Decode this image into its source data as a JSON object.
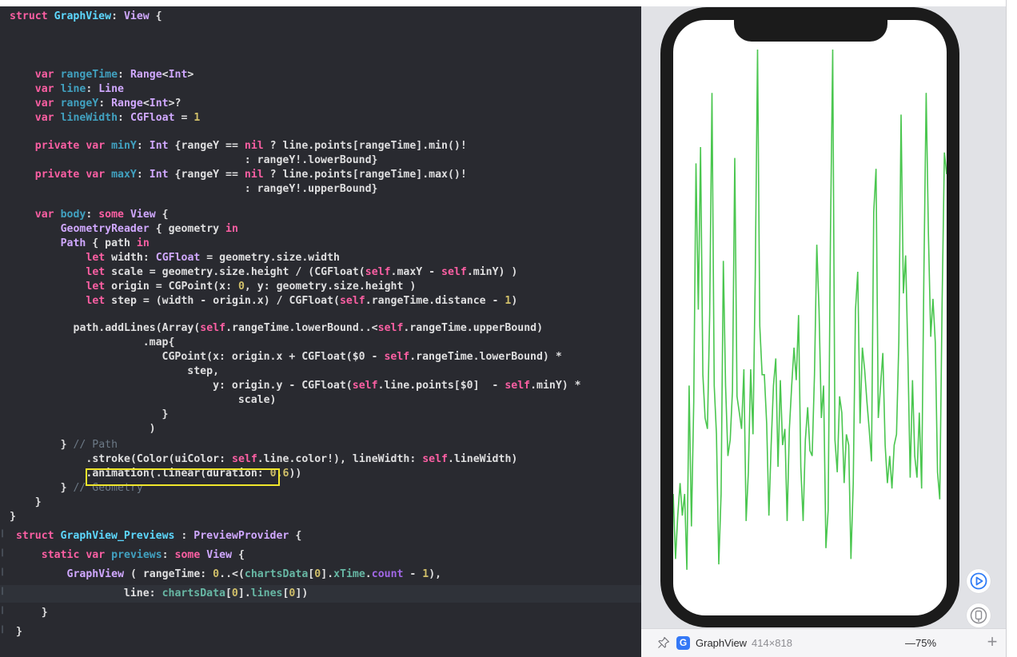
{
  "editor": {
    "lines": [
      {
        "top": 14,
        "indent": 0,
        "tokens": [
          [
            "kw",
            "struct"
          ],
          [
            "plain",
            " "
          ],
          [
            "typeD",
            "GraphView"
          ],
          [
            "plain",
            ": "
          ],
          [
            "type",
            "View"
          ],
          [
            "plain",
            " {"
          ]
        ]
      },
      {
        "top": 58,
        "indent": 4,
        "tokens": [
          [
            "kw",
            "var"
          ],
          [
            "plain",
            " "
          ],
          [
            "prop",
            "rangeTime"
          ],
          [
            "plain",
            ": "
          ],
          [
            "type",
            "Range"
          ],
          [
            "plain",
            "<"
          ],
          [
            "type",
            "Int"
          ],
          [
            "plain",
            ">"
          ]
        ]
      },
      {
        "top": 80,
        "indent": 4,
        "tokens": [
          [
            "kw",
            "var"
          ],
          [
            "plain",
            " "
          ],
          [
            "prop",
            "line"
          ],
          [
            "plain",
            ": "
          ],
          [
            "type",
            "Line"
          ]
        ]
      },
      {
        "top": 102,
        "indent": 4,
        "tokens": [
          [
            "kw",
            "var"
          ],
          [
            "plain",
            " "
          ],
          [
            "prop",
            "rangeY"
          ],
          [
            "plain",
            ": "
          ],
          [
            "type",
            "Range"
          ],
          [
            "plain",
            "<"
          ],
          [
            "type",
            "Int"
          ],
          [
            "plain",
            ">?"
          ]
        ]
      },
      {
        "top": 124,
        "indent": 4,
        "tokens": [
          [
            "kw",
            "var"
          ],
          [
            "plain",
            " "
          ],
          [
            "prop",
            "lineWidth"
          ],
          [
            "plain",
            ": "
          ],
          [
            "type",
            "CGFloat"
          ],
          [
            "plain",
            " = "
          ],
          [
            "num",
            "1"
          ]
        ]
      },
      {
        "top": 168,
        "indent": 4,
        "tokens": [
          [
            "kw",
            "private"
          ],
          [
            "plain",
            " "
          ],
          [
            "kw",
            "var"
          ],
          [
            "plain",
            " "
          ],
          [
            "prop",
            "minY"
          ],
          [
            "plain",
            ": "
          ],
          [
            "type",
            "Int"
          ],
          [
            "plain",
            " {rangeY == "
          ],
          [
            "kw",
            "nil"
          ],
          [
            "plain",
            " ? line.points[rangeTime].min()!"
          ]
        ]
      },
      {
        "top": 190,
        "indent": 0,
        "tokens": [
          [
            "plain",
            "                                     : rangeY!.lowerBound}"
          ]
        ]
      },
      {
        "top": 212,
        "indent": 4,
        "tokens": [
          [
            "kw",
            "private"
          ],
          [
            "plain",
            " "
          ],
          [
            "kw",
            "var"
          ],
          [
            "plain",
            " "
          ],
          [
            "prop",
            "maxY"
          ],
          [
            "plain",
            ": "
          ],
          [
            "type",
            "Int"
          ],
          [
            "plain",
            " {rangeY == "
          ],
          [
            "kw",
            "nil"
          ],
          [
            "plain",
            " ? line.points[rangeTime].max()!"
          ]
        ]
      },
      {
        "top": 234,
        "indent": 0,
        "tokens": [
          [
            "plain",
            "                                     : rangeY!.upperBound}"
          ]
        ]
      },
      {
        "top": 278,
        "indent": 4,
        "tokens": [
          [
            "kw",
            "var"
          ],
          [
            "plain",
            " "
          ],
          [
            "prop",
            "body"
          ],
          [
            "plain",
            ": "
          ],
          [
            "kw",
            "some"
          ],
          [
            "plain",
            " "
          ],
          [
            "type",
            "View"
          ],
          [
            "plain",
            " {"
          ]
        ]
      },
      {
        "top": 300,
        "indent": 8,
        "tokens": [
          [
            "type",
            "GeometryReader"
          ],
          [
            "plain",
            " { geometry "
          ],
          [
            "kw",
            "in"
          ]
        ]
      },
      {
        "top": 322,
        "indent": 8,
        "tokens": [
          [
            "type",
            "Path"
          ],
          [
            "plain",
            " { path "
          ],
          [
            "kw",
            "in"
          ]
        ]
      },
      {
        "top": 344,
        "indent": 12,
        "tokens": [
          [
            "kw",
            "let"
          ],
          [
            "plain",
            " width: "
          ],
          [
            "type",
            "CGFloat"
          ],
          [
            "plain",
            " = geometry.size.width"
          ]
        ]
      },
      {
        "top": 366,
        "indent": 12,
        "tokens": [
          [
            "kw",
            "let"
          ],
          [
            "plain",
            " scale = geometry.size.height / (CGFloat("
          ],
          [
            "kw",
            "self"
          ],
          [
            "plain",
            ".maxY - "
          ],
          [
            "kw",
            "self"
          ],
          [
            "plain",
            ".minY) )"
          ]
        ]
      },
      {
        "top": 388,
        "indent": 12,
        "tokens": [
          [
            "kw",
            "let"
          ],
          [
            "plain",
            " origin = CGPoint(x: "
          ],
          [
            "num",
            "0"
          ],
          [
            "plain",
            ", y: geometry.size.height )"
          ]
        ]
      },
      {
        "top": 410,
        "indent": 12,
        "tokens": [
          [
            "kw",
            "let"
          ],
          [
            "plain",
            " step = (width - origin.x) / CGFloat("
          ],
          [
            "kw",
            "self"
          ],
          [
            "plain",
            ".rangeTime.distance - "
          ],
          [
            "num",
            "1"
          ],
          [
            "plain",
            ")"
          ]
        ]
      },
      {
        "top": 454,
        "indent": 10,
        "tokens": [
          [
            "plain",
            "path.addLines(Array("
          ],
          [
            "kw",
            "self"
          ],
          [
            "plain",
            ".rangeTime.lowerBound..<"
          ],
          [
            "kw",
            "self"
          ],
          [
            "plain",
            ".rangeTime.upperBound)"
          ]
        ]
      },
      {
        "top": 476,
        "indent": 0,
        "tokens": [
          [
            "plain",
            "                     .map{"
          ]
        ]
      },
      {
        "top": 498,
        "indent": 0,
        "tokens": [
          [
            "plain",
            "                        CGPoint(x: origin.x + CGFloat($0 - "
          ],
          [
            "kw",
            "self"
          ],
          [
            "plain",
            ".rangeTime.lowerBound) *"
          ]
        ]
      },
      {
        "top": 520,
        "indent": 0,
        "tokens": [
          [
            "plain",
            "                            step,"
          ]
        ]
      },
      {
        "top": 542,
        "indent": 0,
        "tokens": [
          [
            "plain",
            "                                y: origin.y - CGFloat("
          ],
          [
            "kw",
            "self"
          ],
          [
            "plain",
            ".line.points[$0]  - "
          ],
          [
            "kw",
            "self"
          ],
          [
            "plain",
            ".minY) *"
          ]
        ]
      },
      {
        "top": 564,
        "indent": 0,
        "tokens": [
          [
            "plain",
            "                                    scale)"
          ]
        ]
      },
      {
        "top": 586,
        "indent": 0,
        "tokens": [
          [
            "plain",
            "                        }"
          ]
        ]
      },
      {
        "top": 608,
        "indent": 0,
        "tokens": [
          [
            "plain",
            "                      )"
          ]
        ]
      },
      {
        "top": 630,
        "indent": 8,
        "tokens": [
          [
            "plain",
            "} "
          ],
          [
            "cmt",
            "// Path"
          ]
        ]
      },
      {
        "top": 652,
        "indent": 12,
        "tokens": [
          [
            "plain",
            ".stroke(Color(uiColor: "
          ],
          [
            "kw",
            "self"
          ],
          [
            "plain",
            ".line.color!), lineWidth: "
          ],
          [
            "kw",
            "self"
          ],
          [
            "plain",
            ".lineWidth)"
          ]
        ]
      },
      {
        "top": 674,
        "indent": 12,
        "tokens": [
          [
            "plain",
            ".animation(.linear(duration: "
          ],
          [
            "num",
            "0.6"
          ],
          [
            "plain",
            "))"
          ]
        ]
      },
      {
        "top": 696,
        "indent": 8,
        "tokens": [
          [
            "plain",
            "} "
          ],
          [
            "cmt",
            "// Geometry"
          ]
        ]
      },
      {
        "top": 718,
        "indent": 4,
        "tokens": [
          [
            "plain",
            "}"
          ]
        ]
      },
      {
        "top": 740,
        "indent": 0,
        "tokens": [
          [
            "plain",
            "}"
          ]
        ]
      }
    ],
    "preview_lines": [
      {
        "top": 784,
        "indent": 1,
        "tokens": [
          [
            "kw",
            "struct"
          ],
          [
            "plain",
            " "
          ],
          [
            "typeD",
            "GraphView_Previews"
          ],
          [
            "plain",
            " : "
          ],
          [
            "type",
            "PreviewProvider"
          ],
          [
            "plain",
            " {"
          ]
        ]
      },
      {
        "top": 806,
        "indent": 5,
        "tokens": [
          [
            "kw",
            "static"
          ],
          [
            "plain",
            " "
          ],
          [
            "kw",
            "var"
          ],
          [
            "plain",
            " "
          ],
          [
            "prop",
            "previews"
          ],
          [
            "plain",
            ": "
          ],
          [
            "kw",
            "some"
          ],
          [
            "plain",
            " "
          ],
          [
            "type",
            "View"
          ],
          [
            "plain",
            " {"
          ]
        ]
      },
      {
        "top": 828,
        "indent": 9,
        "tokens": [
          [
            "type",
            "GraphView"
          ],
          [
            "plain",
            " ( rangeTime: "
          ],
          [
            "num",
            "0"
          ],
          [
            "plain",
            "..<("
          ],
          [
            "projvar",
            "chartsData"
          ],
          [
            "plain",
            "["
          ],
          [
            "num",
            "0"
          ],
          [
            "plain",
            "]."
          ],
          [
            "projvar",
            "xTime"
          ],
          [
            "plain",
            "."
          ],
          [
            "projfn",
            "count"
          ],
          [
            "plain",
            " - "
          ],
          [
            "num",
            "1"
          ],
          [
            "plain",
            "),"
          ]
        ]
      },
      {
        "top": 850,
        "indent": 0,
        "highlight": true,
        "tokens": [
          [
            "plain",
            "                  line: "
          ],
          [
            "projvar",
            "chartsData"
          ],
          [
            "plain",
            "["
          ],
          [
            "num",
            "0"
          ],
          [
            "plain",
            "]."
          ],
          [
            "projvar",
            "lines"
          ],
          [
            "plain",
            "["
          ],
          [
            "num",
            "0"
          ],
          [
            "plain",
            "])"
          ]
        ]
      },
      {
        "top": 872,
        "indent": 5,
        "tokens": [
          [
            "plain",
            "}"
          ]
        ]
      },
      {
        "top": 894,
        "indent": 1,
        "tokens": [
          [
            "plain",
            "}"
          ]
        ]
      }
    ]
  },
  "canvas": {
    "preview_name": "GraphView",
    "preview_badge": "G",
    "preview_size": "414×818",
    "zoom_level": "—75%",
    "zoom_in": "+",
    "line_color": "#4ac64f",
    "icons": {
      "pin": "pin-icon",
      "live_preview": "play-circle-icon",
      "device": "device-icon"
    }
  },
  "chart_data": {
    "type": "line",
    "title": "",
    "xlabel": "",
    "ylabel": "",
    "series": [
      {
        "name": "chartsData[0].lines[0]",
        "color": "#4ac64f",
        "values": [
          18,
          6,
          14,
          20,
          14,
          18,
          4,
          38,
          12,
          35,
          79,
          52,
          82,
          40,
          32,
          30,
          51,
          92,
          38,
          29,
          5,
          18,
          61,
          38,
          25,
          28,
          37,
          80,
          36,
          33,
          30,
          41,
          13,
          22,
          41,
          29,
          58,
          100,
          49,
          40,
          40,
          31,
          14,
          27,
          38,
          43,
          23,
          39,
          27,
          30,
          13,
          30,
          38,
          45,
          39,
          51,
          23,
          13,
          28,
          34,
          26,
          25,
          40,
          64,
          52,
          32,
          38,
          8,
          15,
          66,
          100,
          28,
          22,
          36,
          33,
          20,
          29,
          27,
          6,
          20,
          52,
          59,
          31,
          45,
          41,
          35,
          30,
          24,
          70,
          78,
          32,
          38,
          44,
          27,
          20,
          25,
          19,
          27,
          29,
          46,
          88,
          55,
          62,
          43,
          21,
          39,
          25,
          21,
          33,
          19,
          58,
          92,
          66,
          47,
          54,
          46,
          22,
          17,
          53,
          81,
          77
        ]
      }
    ],
    "ylim": [
      0,
      100
    ],
    "grid": false
  }
}
